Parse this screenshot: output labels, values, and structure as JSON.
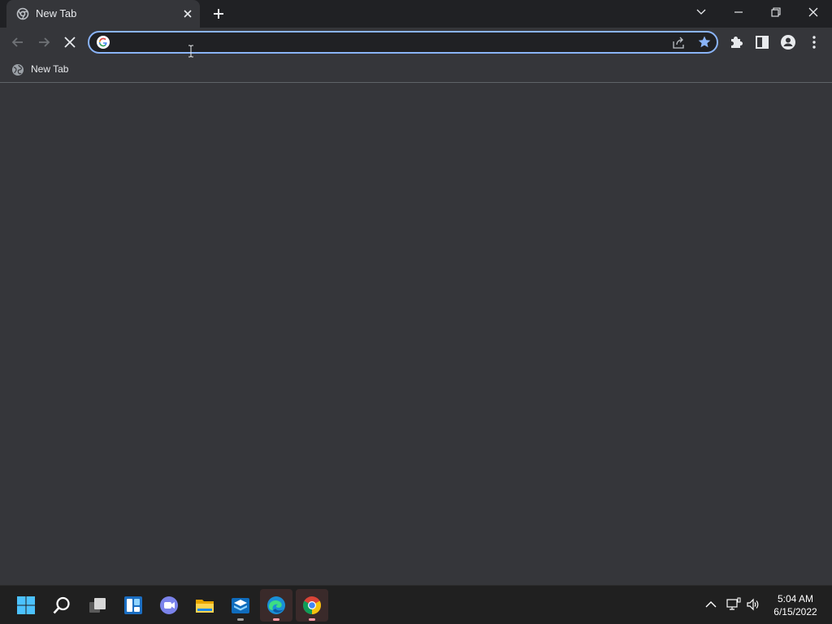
{
  "tab": {
    "title": "New Tab",
    "icon": "chrome-tab-icon",
    "close_icon": "close-icon"
  },
  "titlebar": {
    "new_tab_icon": "plus-icon",
    "tab_search_icon": "chevron-down-icon",
    "minimize_icon": "minimize-icon",
    "restore_icon": "restore-icon",
    "close_icon": "close-icon"
  },
  "toolbar": {
    "back_icon": "back-arrow-icon",
    "forward_icon": "forward-arrow-icon",
    "stop_icon": "stop-icon",
    "omnibox": {
      "value": "",
      "placeholder": "",
      "search_engine_icon": "google-icon",
      "share_icon": "share-icon",
      "bookmark_icon": "star-icon"
    },
    "extensions_icon": "puzzle-icon",
    "side_panel_icon": "side-panel-icon",
    "profile_icon": "profile-icon",
    "menu_icon": "kebab-menu-icon"
  },
  "bookmarks": [
    {
      "label": "New Tab",
      "icon": "globe-icon"
    }
  ],
  "taskbar": {
    "apps": [
      {
        "name": "start",
        "icon": "windows-icon"
      },
      {
        "name": "search",
        "icon": "search-icon"
      },
      {
        "name": "task-view",
        "icon": "task-view-icon"
      },
      {
        "name": "widgets",
        "icon": "widgets-icon"
      },
      {
        "name": "teams-chat",
        "icon": "chat-icon"
      },
      {
        "name": "file-explorer",
        "icon": "folder-icon"
      },
      {
        "name": "store",
        "icon": "store-icon"
      },
      {
        "name": "edge",
        "icon": "edge-icon"
      },
      {
        "name": "chrome",
        "icon": "chrome-icon"
      }
    ],
    "tray": {
      "overflow_icon": "chevron-up-icon",
      "network_icon": "network-icon",
      "volume_icon": "volume-icon"
    },
    "clock": {
      "time": "5:04 AM",
      "date": "6/15/2022"
    }
  },
  "colors": {
    "accent": "#8ab4f8",
    "frame": "#202124",
    "toolbar": "#35363a",
    "taskbar": "#202020"
  }
}
